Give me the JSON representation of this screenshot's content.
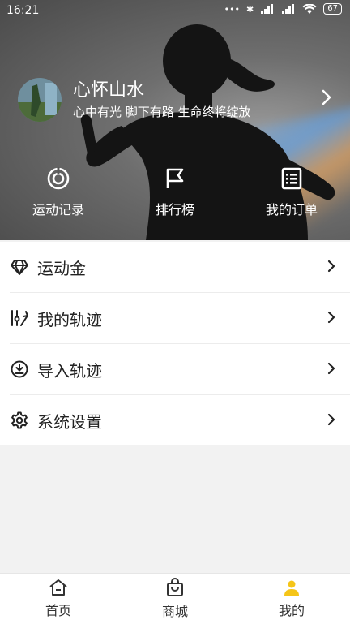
{
  "status": {
    "time": "16:21",
    "battery": "67"
  },
  "profile": {
    "name": "心怀山水",
    "motto": "心中有光 脚下有路 生命终将绽放"
  },
  "quick_actions": [
    {
      "label": "运动记录",
      "icon": "activity-record-icon"
    },
    {
      "label": "排行榜",
      "icon": "flag-icon"
    },
    {
      "label": "我的订单",
      "icon": "order-list-icon"
    }
  ],
  "menu": [
    {
      "label": "运动金",
      "icon": "diamond-icon"
    },
    {
      "label": "我的轨迹",
      "icon": "track-icon"
    },
    {
      "label": "导入轨迹",
      "icon": "download-circle-icon"
    },
    {
      "label": "系统设置",
      "icon": "gear-icon"
    }
  ],
  "tabs": [
    {
      "label": "首页",
      "icon": "home-icon",
      "active": false
    },
    {
      "label": "商城",
      "icon": "shopping-bag-icon",
      "active": false
    },
    {
      "label": "我的",
      "icon": "person-icon",
      "active": true
    }
  ],
  "colors": {
    "accent": "#f5c518",
    "text": "#222222",
    "background": "#f2f2f2"
  }
}
